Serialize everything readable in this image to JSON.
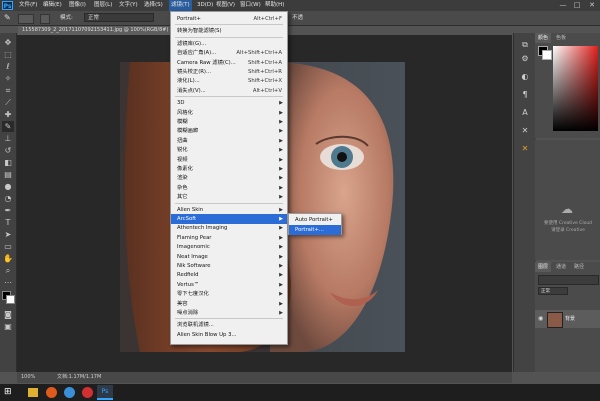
{
  "menubar": {
    "app_icon": "Ps",
    "items": [
      "文件(F)",
      "编辑(E)",
      "图像(I)",
      "图层(L)",
      "文字(Y)",
      "选择(S)",
      "滤镜(T)",
      "3D(D)",
      "视图(V)",
      "窗口(W)",
      "帮助(H)"
    ],
    "active_item": "滤镜(T)",
    "window_controls": [
      "—",
      "□",
      "✕"
    ]
  },
  "options": {
    "mode_label": "模式:",
    "mode_value": "正常",
    "trailing_label": "不透"
  },
  "document": {
    "tab_title": "115587309_2_20171107092153411.jpg @ 100%(RGB/8#)",
    "zoom": "100%",
    "doc_info": "文档:1.17M/1.17M"
  },
  "filter_menu": {
    "items": [
      {
        "label": "Portrait+",
        "shortcut": "Alt+Ctrl+F"
      },
      {
        "label": "转换为智能滤镜(S)"
      },
      {
        "label": "滤镜库(G)..."
      },
      {
        "label": "自适应广角(A)...",
        "shortcut": "Alt+Shift+Ctrl+A"
      },
      {
        "label": "Camera Raw 滤镜(C)...",
        "shortcut": "Shift+Ctrl+A"
      },
      {
        "label": "镜头校正(R)...",
        "shortcut": "Shift+Ctrl+R"
      },
      {
        "label": "液化(L)...",
        "shortcut": "Shift+Ctrl+X"
      },
      {
        "label": "消失点(V)...",
        "shortcut": "Alt+Ctrl+V"
      },
      {
        "label": "3D",
        "submenu": true
      },
      {
        "label": "风格化",
        "submenu": true
      },
      {
        "label": "模糊",
        "submenu": true
      },
      {
        "label": "模糊画廊",
        "submenu": true
      },
      {
        "label": "扭曲",
        "submenu": true
      },
      {
        "label": "锐化",
        "submenu": true
      },
      {
        "label": "视频",
        "submenu": true
      },
      {
        "label": "像素化",
        "submenu": true
      },
      {
        "label": "渲染",
        "submenu": true
      },
      {
        "label": "杂色",
        "submenu": true
      },
      {
        "label": "其它",
        "submenu": true
      },
      {
        "label": "Alien Skin",
        "submenu": true
      },
      {
        "label": "ArcSoft",
        "submenu": true,
        "highlighted": true
      },
      {
        "label": "Athentech Imaging",
        "submenu": true
      },
      {
        "label": "Flaming Pear",
        "submenu": true
      },
      {
        "label": "Imagenomic",
        "submenu": true
      },
      {
        "label": "Neat Image",
        "submenu": true
      },
      {
        "label": "Nik Software",
        "submenu": true
      },
      {
        "label": "Redfield",
        "submenu": true
      },
      {
        "label": "Vertus™",
        "submenu": true
      },
      {
        "label": "零下七度汉化",
        "submenu": true
      },
      {
        "label": "美容",
        "submenu": true
      },
      {
        "label": "噪点消除",
        "submenu": true
      },
      {
        "label": "浏览联机滤镜..."
      },
      {
        "label": "Alien Skin Blow Up 3..."
      }
    ]
  },
  "submenu": {
    "items": [
      "Auto Portrait+",
      "Portrait+..."
    ],
    "highlighted": "Portrait+..."
  },
  "panels": {
    "color_tabs": [
      "颜色",
      "色板"
    ],
    "library_text": [
      "要使用 Creative Cloud",
      "请登录 Creative"
    ],
    "layers_tabs": [
      "图层",
      "通道",
      "路径"
    ],
    "blend_mode": "正常",
    "layer_name": "背景"
  },
  "colors": {
    "menu_highlight": "#2b6cd6",
    "ps_blue": "#31a8ff"
  }
}
